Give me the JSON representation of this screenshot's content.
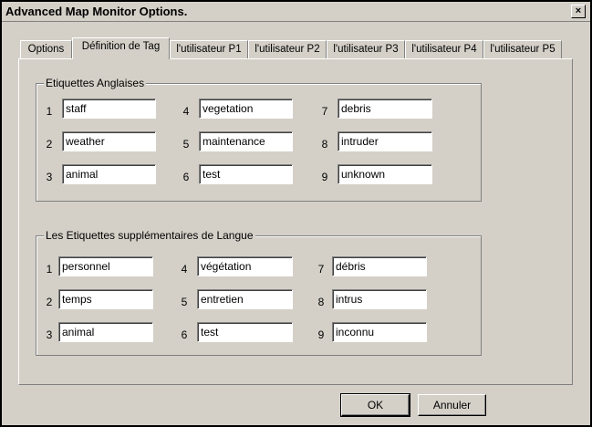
{
  "window": {
    "title": "Advanced Map Monitor Options.",
    "close_label": "×"
  },
  "tabs": [
    {
      "label": "Options"
    },
    {
      "label": "Définition de Tag"
    },
    {
      "label": "l'utilisateur P1"
    },
    {
      "label": "l'utilisateur P2"
    },
    {
      "label": "l'utilisateur P3"
    },
    {
      "label": "l'utilisateur P4"
    },
    {
      "label": "l'utilisateur P5"
    }
  ],
  "english_group": {
    "label": "Etiquettes Anglaises",
    "items": [
      {
        "num": "1",
        "value": "staff"
      },
      {
        "num": "2",
        "value": "weather"
      },
      {
        "num": "3",
        "value": "animal"
      },
      {
        "num": "4",
        "value": "vegetation"
      },
      {
        "num": "5",
        "value": "maintenance"
      },
      {
        "num": "6",
        "value": "test"
      },
      {
        "num": "7",
        "value": "debris"
      },
      {
        "num": "8",
        "value": "intruder"
      },
      {
        "num": "9",
        "value": "unknown"
      }
    ]
  },
  "language_group": {
    "label": "Les Etiquettes supplémentaires de Langue",
    "items": [
      {
        "num": "1",
        "value": "personnel"
      },
      {
        "num": "2",
        "value": "temps"
      },
      {
        "num": "3",
        "value": "animal"
      },
      {
        "num": "4",
        "value": "végétation"
      },
      {
        "num": "5",
        "value": "entretien"
      },
      {
        "num": "6",
        "value": "test"
      },
      {
        "num": "7",
        "value": "débris"
      },
      {
        "num": "8",
        "value": "intrus"
      },
      {
        "num": "9",
        "value": "inconnu"
      }
    ]
  },
  "buttons": {
    "ok": "OK",
    "cancel": "Annuler"
  }
}
